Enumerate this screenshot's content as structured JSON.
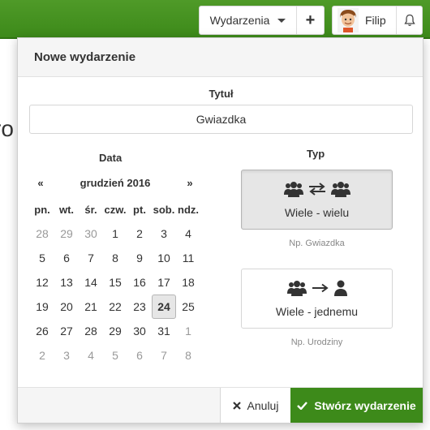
{
  "colors": {
    "brand_green": "#3d8a1a",
    "selected_gray": "#e6e6e6"
  },
  "navbar": {
    "events_label": "Wydarzenia",
    "add_icon": "plus-icon",
    "user_name": "Filip",
    "notifications_icon": "bell-icon"
  },
  "background": {
    "partial_text": "ro"
  },
  "modal": {
    "title": "Nowe wydarzenie",
    "title_field": {
      "label": "Tytuł",
      "value": "Gwiazdka"
    },
    "date": {
      "label": "Data",
      "prev": "«",
      "next": "»",
      "month": "grudzień 2016",
      "weekdays": [
        "pn.",
        "wt.",
        "śr.",
        "czw.",
        "pt.",
        "sob.",
        "ndz."
      ],
      "weeks": [
        [
          "28",
          "29",
          "30",
          "1",
          "2",
          "3",
          "4"
        ],
        [
          "5",
          "6",
          "7",
          "8",
          "9",
          "10",
          "11"
        ],
        [
          "12",
          "13",
          "14",
          "15",
          "16",
          "17",
          "18"
        ],
        [
          "19",
          "20",
          "21",
          "22",
          "23",
          "24",
          "25"
        ],
        [
          "26",
          "27",
          "28",
          "29",
          "30",
          "31",
          "1"
        ],
        [
          "2",
          "3",
          "4",
          "5",
          "6",
          "7",
          "8"
        ]
      ],
      "selected": "24"
    },
    "type": {
      "label": "Typ",
      "options": [
        {
          "name": "Wiele - wielu",
          "hint": "Np. Gwiazdka",
          "selected": true,
          "icon": "group-exchange-group-icon"
        },
        {
          "name": "Wiele - jednemu",
          "hint": "Np. Urodziny",
          "selected": false,
          "icon": "group-to-user-icon"
        }
      ]
    },
    "cancel_label": "Anuluj",
    "create_label": "Stwórz wydarzenie"
  }
}
